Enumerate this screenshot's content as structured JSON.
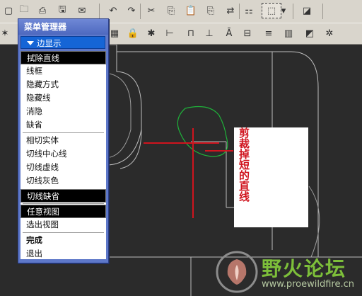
{
  "menu": {
    "title": "菜单管理器",
    "submenu": "边显示",
    "items": [
      "拭除直线",
      "线框",
      "隐藏方式",
      "隐藏线",
      "消隐",
      "缺省",
      "相切实体",
      "切线中心线",
      "切线虚线",
      "切线灰色",
      "切线缺省",
      "任意视图",
      "选出视图",
      "完成",
      "退出"
    ],
    "highlighted": [
      "拭除直线",
      "切线缺省",
      "任意视图"
    ]
  },
  "annotation": {
    "text": "剪裁掉短的直线",
    "color": "#d0141e"
  },
  "watermark": {
    "text": "野火论坛",
    "url": "www.proewildfire.cn"
  },
  "colors": {
    "menu_bg": "#5e78c9",
    "canvas": "#2b2b2b",
    "toolbar": "#d9d5cc",
    "red_line": "#d0141e",
    "green_curve": "#1fb23a"
  },
  "toolbar_icons": [
    "new-icon",
    "open-icon",
    "save-icon",
    "undo-icon",
    "redo-icon",
    "cut-icon",
    "copy-icon",
    "paste-icon",
    "regenerate-icon",
    "select-box-icon",
    "view-icon",
    "datum-icon",
    "orient-icon",
    "lock-icon"
  ]
}
